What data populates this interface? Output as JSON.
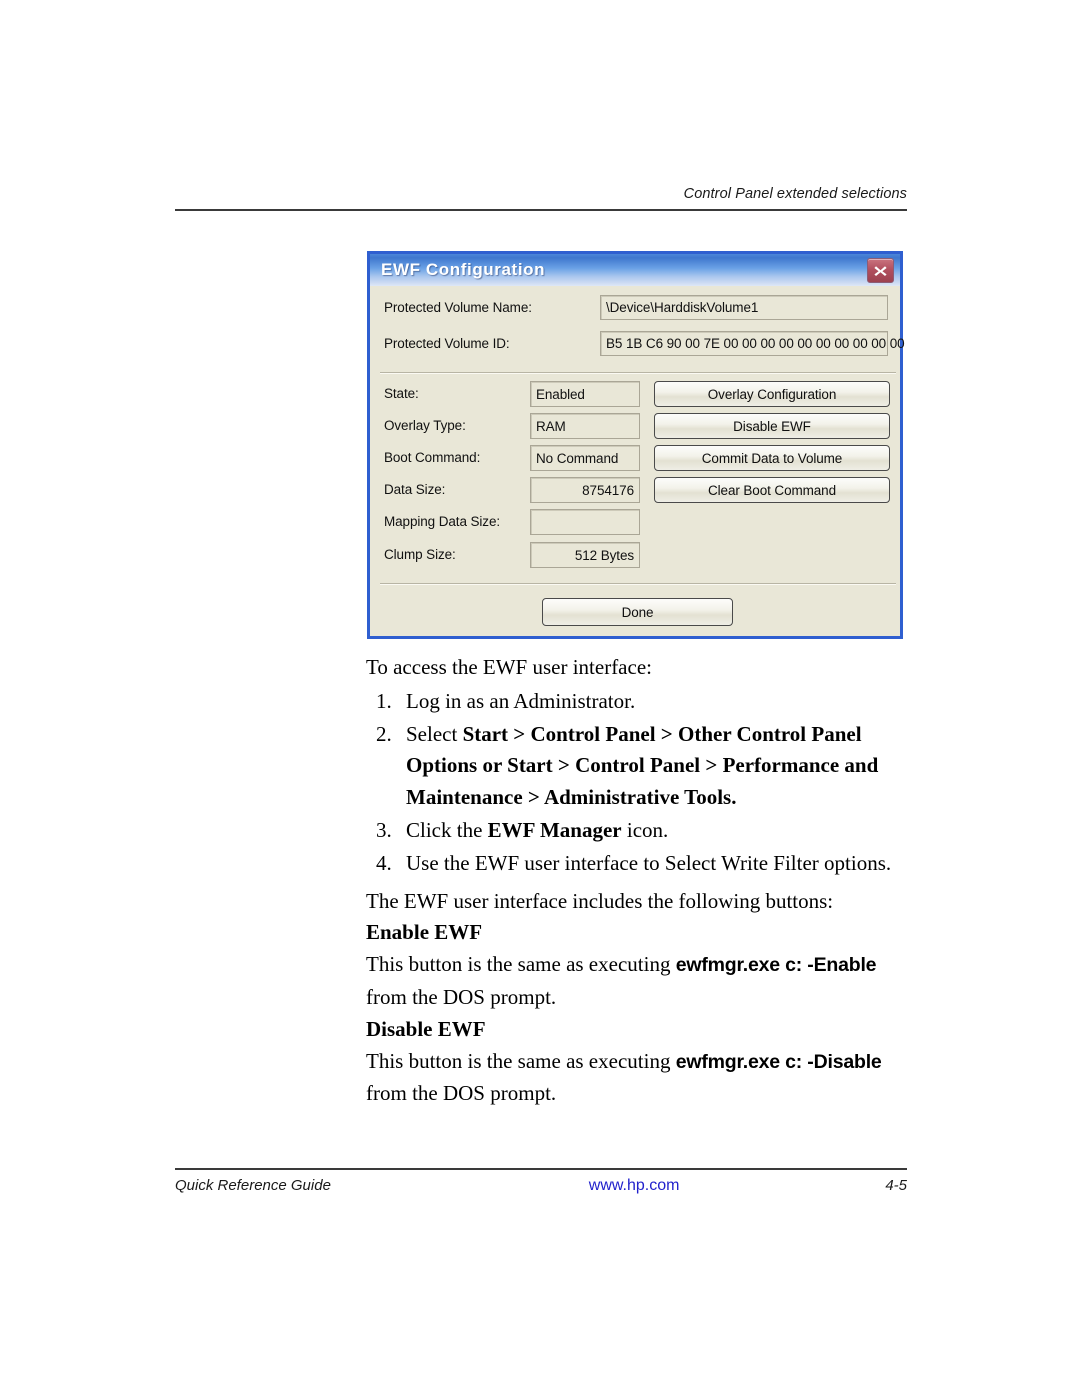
{
  "header": {
    "running_head": "Control Panel extended selections"
  },
  "dialog": {
    "title": "EWF Configuration",
    "close_icon": "close-icon",
    "fields": [
      {
        "label": "Protected Volume Name:",
        "value": "\\Device\\HarddiskVolume1",
        "align": "left"
      },
      {
        "label": "Protected Volume ID:",
        "value": "B5 1B C6 90 00 7E 00 00 00 00 00 00 00 00 00 00",
        "align": "left"
      },
      {
        "label": "State:",
        "value": "Enabled",
        "align": "left"
      },
      {
        "label": "Overlay Type:",
        "value": "RAM",
        "align": "left"
      },
      {
        "label": "Boot Command:",
        "value": "No Command",
        "align": "left"
      },
      {
        "label": "Data Size:",
        "value": "8754176",
        "align": "right"
      },
      {
        "label": "Mapping Data Size:",
        "value": "",
        "align": "right"
      },
      {
        "label": "Clump Size:",
        "value": "512 Bytes",
        "align": "right"
      }
    ],
    "buttons": [
      "Overlay Configuration",
      "Disable EWF",
      "Commit Data to Volume",
      "Clear Boot Command"
    ],
    "done_button": "Done",
    "colors": {
      "face": "#e9e7d7",
      "title_bar_start": "#4b86d8",
      "title_bar_end": "#dfe8f6",
      "border": "#2f5fd0",
      "close_button": "#b2505f"
    }
  },
  "body": {
    "intro": "To access the EWF user interface:",
    "steps": [
      {
        "num": "1.",
        "segments": [
          {
            "text": "Log in as an Administrator.",
            "style": "normal"
          }
        ]
      },
      {
        "num": "2.",
        "segments": [
          {
            "text": "Select ",
            "style": "normal"
          },
          {
            "text": "Start > Control Panel > Other Control Panel Options or Start > Control Panel > Performance and Maintenance > Administrative Tools.",
            "style": "bold"
          }
        ]
      },
      {
        "num": "3.",
        "segments": [
          {
            "text": "Click the ",
            "style": "normal"
          },
          {
            "text": "EWF Manager",
            "style": "bold"
          },
          {
            "text": " icon.",
            "style": "normal"
          }
        ]
      },
      {
        "num": "4.",
        "segments": [
          {
            "text": "Use the EWF user interface to Select Write Filter options.",
            "style": "normal"
          }
        ]
      }
    ],
    "buttons_lead_in": "The EWF user interface includes the following buttons:",
    "sections": [
      {
        "heading": "Enable EWF",
        "text_before": "This button is the same as executing ",
        "command": "ewfmgr.exe c: -Enable",
        "text_after": " from the DOS prompt."
      },
      {
        "heading": "Disable EWF",
        "text_before": "This button is the same as executing ",
        "command": "ewfmgr.exe c: -Disable",
        "text_after": " from the DOS prompt."
      }
    ]
  },
  "footer": {
    "left": "Quick Reference Guide",
    "center": "www.hp.com",
    "right": "4-5",
    "link_color": "#2222cc"
  }
}
